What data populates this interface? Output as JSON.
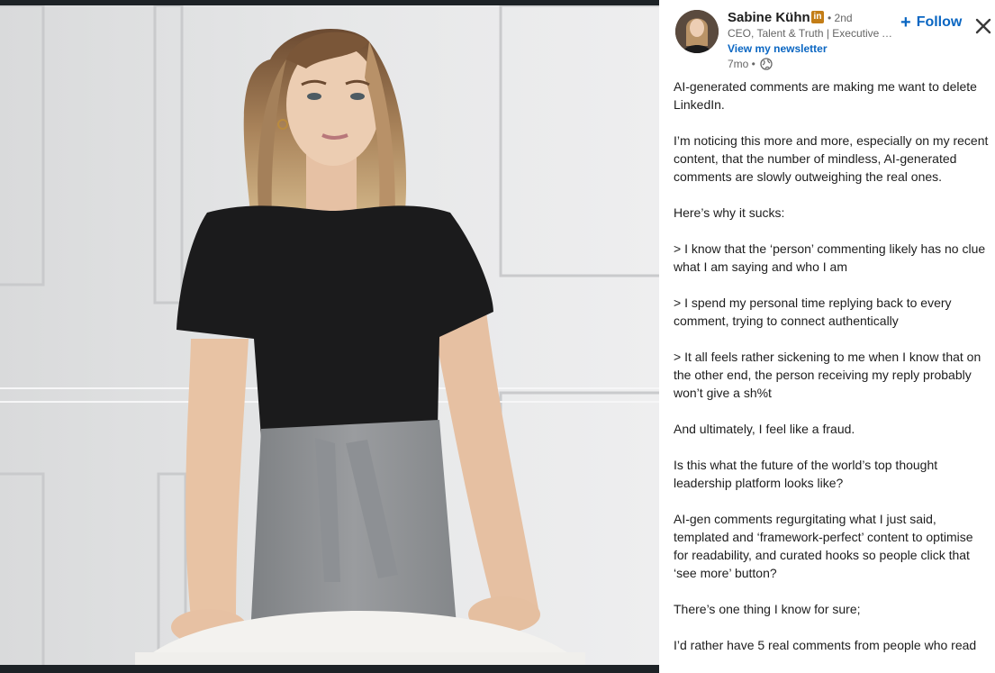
{
  "photo": {
    "alt_icon": "post-photo"
  },
  "actor": {
    "name": "Sabine Kühn",
    "badge": "in",
    "degree": "• 2nd",
    "headline": "CEO, Talent & Truth | Executive Advisor",
    "newsletter_link": "View my newsletter",
    "time": "7mo •",
    "visibility_icon": "globe-icon"
  },
  "follow_button": {
    "icon": "plus-icon",
    "label": "Follow"
  },
  "close_button": {
    "icon": "close-icon"
  },
  "post": {
    "paragraphs": [
      "AI-generated comments are making me want to delete LinkedIn.",
      "I’m noticing this more and more, especially on my recent content, that the number of mindless, AI-generated comments are slowly outweighing the real ones.",
      "Here’s why it sucks:",
      "> I know that the ‘person’ commenting likely has no clue what I am saying and who I am",
      "> I spend my personal time replying back to every comment, trying to connect authentically",
      "> It all feels rather sickening to me when I know that on the other end, the person receiving my reply probably won’t give a sh%t",
      "And ultimately, I feel like a fraud.",
      "Is this what the future of the world’s top thought leadership platform looks like?",
      "AI-gen comments regurgitating what I just said, templated and ‘framework-perfect’ content to optimise for readability, and curated hooks so people click that ‘see more’ button?",
      "There’s one thing I know for sure;",
      "I’d rather have 5 real comments from people who read"
    ]
  },
  "colors": {
    "link": "#0a66c2",
    "text": "#1d1d1d",
    "muted": "#666666",
    "premium_badge": "#c37d16",
    "backdrop": "#1d2226"
  }
}
